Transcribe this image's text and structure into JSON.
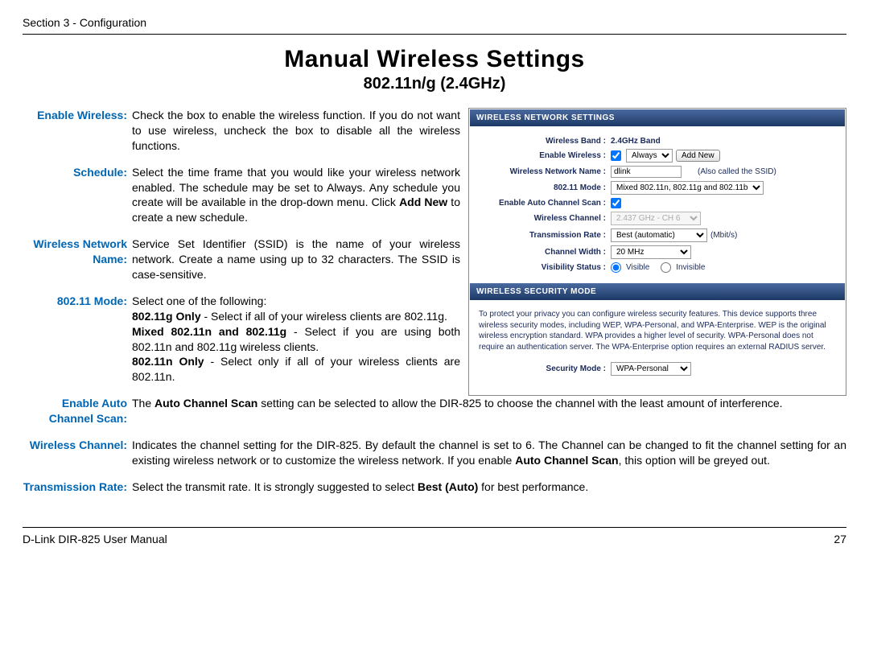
{
  "header": {
    "section": "Section 3 - Configuration"
  },
  "title": {
    "main": "Manual Wireless Settings",
    "sub": "802.11n/g (2.4GHz)"
  },
  "desc": {
    "enable_wireless": {
      "label": "Enable Wireless:",
      "text": "Check the box to enable the wireless function. If you do not want to use wireless, uncheck the box to disable all the wireless functions."
    },
    "schedule": {
      "label": "Schedule:",
      "text_pre": "Select the time frame that you would like your wireless network enabled. The schedule may be set to Always. Any schedule you create will be available in the drop-down menu. Click ",
      "text_bold": "Add New",
      "text_post": " to create a new schedule."
    },
    "network_name": {
      "label1": "Wireless Network",
      "label2": "Name:",
      "text": "Service Set Identifier (SSID) is the name of your wireless network. Create a name using up to 32 characters. The SSID is case-sensitive."
    },
    "mode": {
      "label": "802.11 Mode:",
      "intro": "Select one of the following:",
      "g_only_b": "802.11g Only",
      "g_only_t": " - Select if all of your wireless clients are 802.11g.",
      "mixed_b": "Mixed 802.11n and 802.11g",
      "mixed_t": " - Select if you are using both 802.11n and 802.11g wireless clients.",
      "n_only_b": "802.11n Only",
      "n_only_t": " - Select only if all of your wireless clients are 802.11n."
    },
    "auto_scan": {
      "label1": "Enable Auto",
      "label2": "Channel Scan:",
      "text_pre": "The ",
      "text_b": "Auto Channel Scan",
      "text_post": " setting can be selected to allow the DIR-825 to choose the channel with the least amount of interference."
    },
    "channel": {
      "label": "Wireless Channel:",
      "text_pre": "Indicates the channel setting for the DIR-825. By default the channel is set to 6. The Channel can be changed to fit the channel setting for an existing wireless network or to customize the wireless network. If you enable ",
      "text_b": "Auto Channel Scan",
      "text_post": ", this option will be greyed out."
    },
    "rate": {
      "label": "Transmission Rate:",
      "text_pre": "Select the transmit rate. It is strongly suggested to select ",
      "text_b": "Best (Auto)",
      "text_post": " for best performance."
    }
  },
  "panel": {
    "settings_header": "WIRELESS NETWORK SETTINGS",
    "security_header": "WIRELESS SECURITY MODE",
    "labels": {
      "band": "Wireless Band :",
      "enable": "Enable Wireless :",
      "name": "Wireless Network Name :",
      "mode": "802.11 Mode :",
      "auto": "Enable Auto Channel Scan :",
      "channel": "Wireless Channel :",
      "rate": "Transmission Rate :",
      "width": "Channel Width :",
      "visibility": "Visibility Status :",
      "security": "Security Mode :"
    },
    "values": {
      "band": "2.4GHz Band",
      "schedule": "Always",
      "add_new": "Add New",
      "ssid": "dlink",
      "ssid_note": "(Also called the SSID)",
      "mode": "Mixed 802.11n, 802.11g and 802.11b",
      "channel": "2.437 GHz - CH 6",
      "rate": "Best (automatic)",
      "rate_unit": "(Mbit/s)",
      "width": "20 MHz",
      "vis_visible": "Visible",
      "vis_invisible": "Invisible",
      "security": "WPA-Personal"
    },
    "security_desc": "To protect your privacy you can configure wireless security features. This device supports three wireless security modes, including WEP, WPA-Personal, and WPA-Enterprise. WEP is the original wireless encryption standard. WPA provides a higher level of security. WPA-Personal does not require an authentication server. The WPA-Enterprise option requires an external RADIUS server."
  },
  "footer": {
    "left": "D-Link DIR-825 User Manual",
    "right": "27"
  }
}
